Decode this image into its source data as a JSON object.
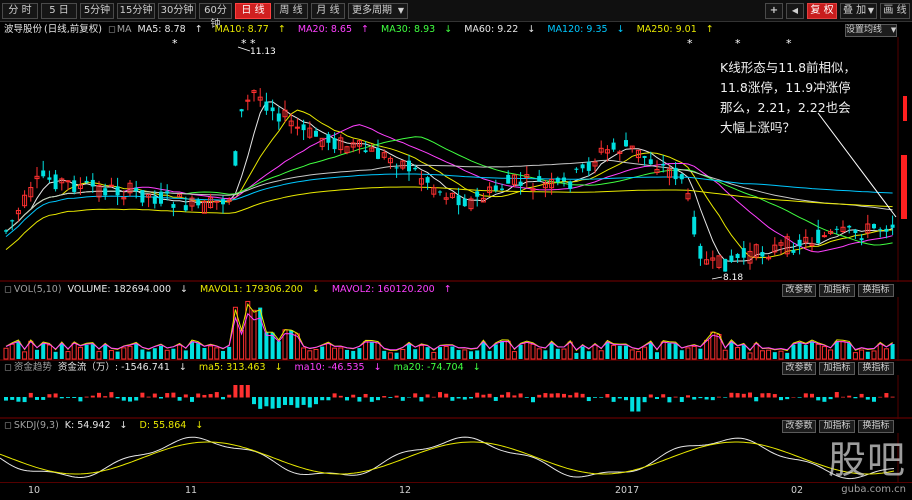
{
  "toolbar": {
    "period_buttons": [
      "分 时",
      "5 日",
      "5分钟",
      "15分钟",
      "30分钟",
      "60分钟",
      "日 线",
      "周 线",
      "月 线",
      "更多周期"
    ],
    "active_period": "日 线",
    "zoom_in": "+",
    "nav_left": "◀",
    "fuquan": "复 权",
    "overlay": "叠 加",
    "draw": "画 线"
  },
  "main_header": {
    "stock": "波导股份",
    "mode": "(日线,前复权)",
    "ma_label": "MA",
    "ma": [
      {
        "text": "MA5: 8.78",
        "arrow": "↑",
        "color": "#e6e6e6"
      },
      {
        "text": "MA10: 8.77",
        "arrow": "↑",
        "color": "#e8e800"
      },
      {
        "text": "MA20: 8.65",
        "arrow": "↑",
        "color": "#ff40ff"
      },
      {
        "text": "MA30: 8.93",
        "arrow": "↓",
        "color": "#40ff40"
      },
      {
        "text": "MA60: 9.22",
        "arrow": "↓",
        "color": "#c8c8c8"
      },
      {
        "text": "MA120: 9.35",
        "arrow": "↓",
        "color": "#00c8ff"
      },
      {
        "text": "MA250: 9.01",
        "arrow": "↑",
        "color": "#e8e800"
      }
    ],
    "settings_button": "设置均线"
  },
  "price_labels": {
    "high": "11.13",
    "low": "8.18"
  },
  "annotation": "K线形态与11.8前相似，\n11.8涨停，11.9冲涨停\n那么，2.21，2.22也会\n大幅上涨吗？",
  "vol_header": {
    "label": "VOL(5,10)",
    "volume": "VOLUME: 182694.000",
    "volume_arrow": "↓",
    "mavol1": "MAVOL1: 179306.200",
    "mavol1_arrow": "↓",
    "mavol2": "MAVOL2: 160120.200",
    "mavol2_arrow": "↑"
  },
  "fund_header": {
    "label": "资金趋势",
    "flow": "资金流（万）: -1546.741",
    "flow_arrow": "↓",
    "ma5": "ma5: 313.463",
    "ma5_arrow": "↓",
    "ma10": "ma10: -46.535",
    "ma10_arrow": "↓",
    "ma20": "ma20: -74.704",
    "ma20_arrow": "↓"
  },
  "kdj_header": {
    "label": "SKDJ(9,3)",
    "k": "K: 54.942",
    "k_arrow": "↓",
    "d": "D: 55.864",
    "d_arrow": "↓"
  },
  "panel_buttons": {
    "params": "改参数",
    "add": "加指标",
    "switch": "换指标"
  },
  "date_axis": [
    {
      "label": "10"
    },
    {
      "label": "11"
    },
    {
      "label": "12"
    },
    {
      "label": "2017"
    },
    {
      "label": "02"
    }
  ],
  "watermark": {
    "big": "股吧",
    "small": "guba.com.cn"
  },
  "colors": {
    "up": "#ff3030",
    "down": "#00e0e0",
    "ma5": "#e6e6e6",
    "ma10": "#e8e800",
    "ma20": "#ff40ff",
    "ma30": "#40ff40",
    "ma60": "#c8c8c8",
    "ma120": "#00c8ff",
    "ma250": "#e8e800"
  }
}
